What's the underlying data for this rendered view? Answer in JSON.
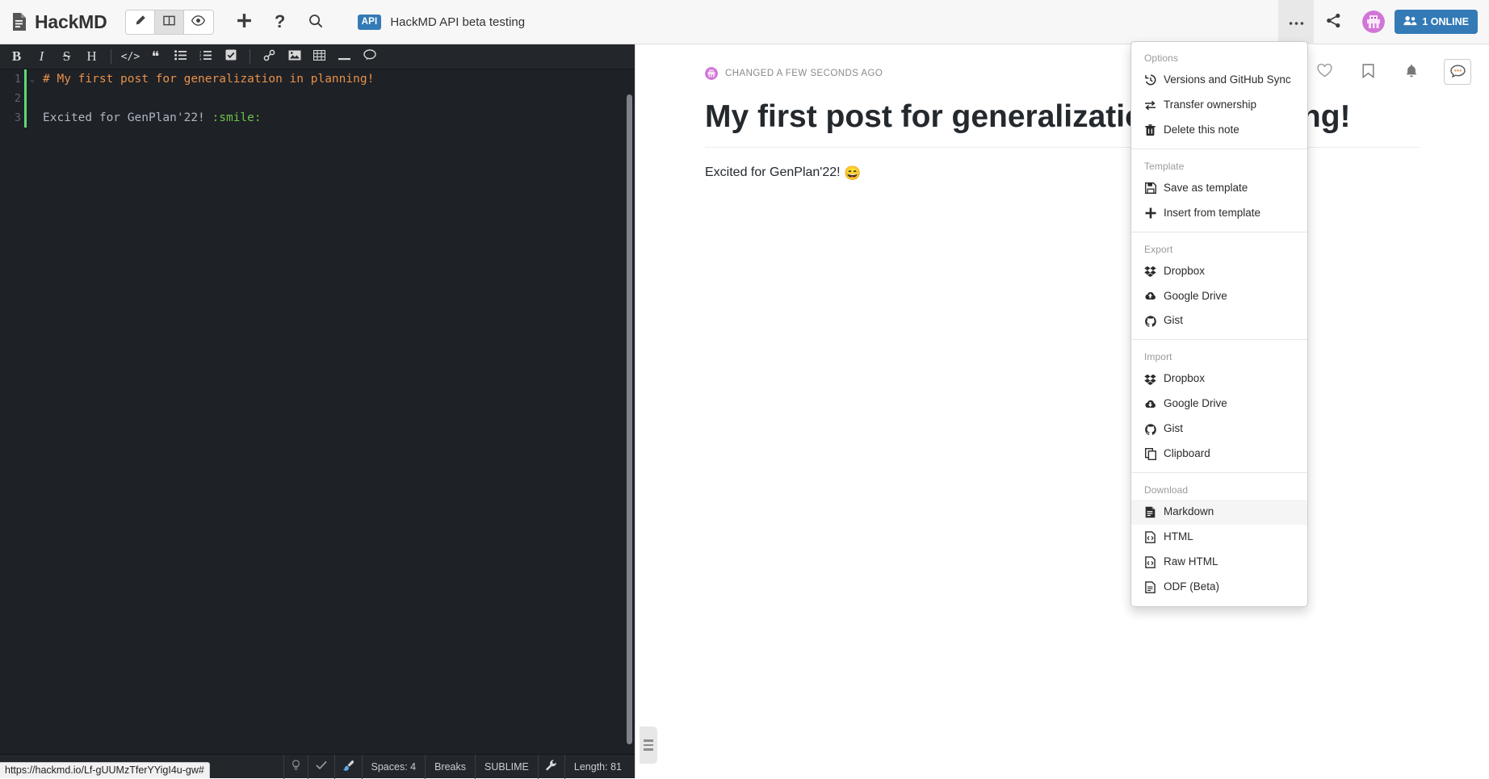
{
  "navbar": {
    "brand": "HackMD",
    "brand_icon": "document-icon",
    "modes": [
      {
        "name": "edit",
        "icon": "pencil-icon",
        "active": false
      },
      {
        "name": "both",
        "icon": "columns-icon",
        "active": true
      },
      {
        "name": "preview",
        "icon": "eye-icon",
        "active": false
      }
    ],
    "left_icons": [
      {
        "name": "new-note",
        "icon": "plus-icon"
      },
      {
        "name": "help",
        "icon": "question-icon"
      },
      {
        "name": "search",
        "icon": "search-icon"
      }
    ],
    "api_chip": "API",
    "note_title": "HackMD API beta testing",
    "more_icon": "ellipsis-icon",
    "share_icon": "share-icon",
    "avatar": "user-avatar",
    "online_label": "1 ONLINE",
    "online_icon": "users-icon"
  },
  "editor": {
    "toolbar": [
      {
        "name": "bold",
        "glyph": "B",
        "style": "serif-bold"
      },
      {
        "name": "italic",
        "glyph": "I",
        "style": "serif-italic"
      },
      {
        "name": "strikethrough",
        "glyph": "S",
        "style": "serif-strike"
      },
      {
        "name": "heading",
        "glyph": "H",
        "style": "serif"
      },
      {
        "name": "separator-1",
        "glyph": "",
        "style": "sep"
      },
      {
        "name": "code",
        "glyph": "</>",
        "style": "mono"
      },
      {
        "name": "quote",
        "glyph": "❝",
        "style": "plain"
      },
      {
        "name": "unordered-list",
        "glyph": "",
        "style": "ul"
      },
      {
        "name": "ordered-list",
        "glyph": "",
        "style": "ol"
      },
      {
        "name": "check-list",
        "glyph": "",
        "style": "check"
      },
      {
        "name": "separator-2",
        "glyph": "",
        "style": "sep"
      },
      {
        "name": "link",
        "glyph": "",
        "style": "link"
      },
      {
        "name": "image",
        "glyph": "",
        "style": "image"
      },
      {
        "name": "table",
        "glyph": "",
        "style": "table"
      },
      {
        "name": "horizontal-rule",
        "glyph": "",
        "style": "hr"
      },
      {
        "name": "comment",
        "glyph": "",
        "style": "bubble"
      }
    ],
    "lines": [
      {
        "number": "1",
        "foldable": true,
        "segments": [
          {
            "text": "# My first post for generalization in planning!",
            "type": "head"
          }
        ]
      },
      {
        "number": "2",
        "foldable": false,
        "segments": []
      },
      {
        "number": "3",
        "foldable": false,
        "segments": [
          {
            "text": "Excited for GenPlan'22! ",
            "type": "text"
          },
          {
            "text": ":smile:",
            "type": "emoji"
          }
        ]
      }
    ],
    "statusbar": [
      {
        "name": "hint",
        "label": "",
        "icon": "lightbulb-icon"
      },
      {
        "name": "spellcheck",
        "label": "",
        "icon": "check-icon"
      },
      {
        "name": "theme",
        "label": "",
        "icon": "brush-icon"
      },
      {
        "name": "indentation",
        "label": "Spaces: 4",
        "icon": ""
      },
      {
        "name": "line-ending",
        "label": "Breaks",
        "icon": ""
      },
      {
        "name": "keymap",
        "label": "SUBLIME",
        "icon": ""
      },
      {
        "name": "settings",
        "label": "",
        "icon": "wrench-icon"
      },
      {
        "name": "length",
        "label": "Length: 81",
        "icon": ""
      }
    ],
    "url_tooltip": "https://hackmd.io/Lf-gUUMzTferYYigI4u-gw#"
  },
  "preview": {
    "actions": [
      {
        "name": "like",
        "icon": "heart-icon"
      },
      {
        "name": "bookmark",
        "icon": "bookmark-icon"
      },
      {
        "name": "subscribe",
        "icon": "bell-icon"
      },
      {
        "name": "comments",
        "icon": "comment-bubble-icon"
      }
    ],
    "changed_text": "CHANGED A FEW SECONDS AGO",
    "changed_avatar": "user-avatar-mini",
    "heading": "My first post for generalization in planning!",
    "paragraph": "Excited for GenPlan'22! ",
    "paragraph_emoji": "😄",
    "drag_handle": "resize-handle"
  },
  "more_menu": {
    "sections": [
      {
        "header": "Options",
        "items": [
          {
            "label": "Versions and GitHub Sync",
            "icon": "history-icon",
            "hovered": false
          },
          {
            "label": "Transfer ownership",
            "icon": "exchange-icon",
            "hovered": false
          },
          {
            "label": "Delete this note",
            "icon": "trash-icon",
            "hovered": false
          }
        ]
      },
      {
        "header": "Template",
        "items": [
          {
            "label": "Save as template",
            "icon": "save-icon",
            "hovered": false
          },
          {
            "label": "Insert from template",
            "icon": "plus-icon",
            "hovered": false
          }
        ]
      },
      {
        "header": "Export",
        "items": [
          {
            "label": "Dropbox",
            "icon": "dropbox-icon",
            "hovered": false
          },
          {
            "label": "Google Drive",
            "icon": "cloud-upload-icon",
            "hovered": false
          },
          {
            "label": "Gist",
            "icon": "github-icon",
            "hovered": false
          }
        ]
      },
      {
        "header": "Import",
        "items": [
          {
            "label": "Dropbox",
            "icon": "dropbox-icon",
            "hovered": false
          },
          {
            "label": "Google Drive",
            "icon": "cloud-download-icon",
            "hovered": false
          },
          {
            "label": "Gist",
            "icon": "github-icon",
            "hovered": false
          },
          {
            "label": "Clipboard",
            "icon": "clipboard-icon",
            "hovered": false
          }
        ]
      },
      {
        "header": "Download",
        "items": [
          {
            "label": "Markdown",
            "icon": "file-markdown-icon",
            "hovered": true
          },
          {
            "label": "HTML",
            "icon": "file-code-icon",
            "hovered": false
          },
          {
            "label": "Raw HTML",
            "icon": "file-code-icon",
            "hovered": false
          },
          {
            "label": "ODF (Beta)",
            "icon": "file-text-icon",
            "hovered": false
          }
        ]
      }
    ]
  },
  "colors": {
    "accent": "#337ab7",
    "editor_bg": "#1e2126",
    "toolbar_bg": "#23262b",
    "heading_orange": "#e8914a",
    "emoji_green": "#6cc24a",
    "cursor_green": "#60d977"
  }
}
